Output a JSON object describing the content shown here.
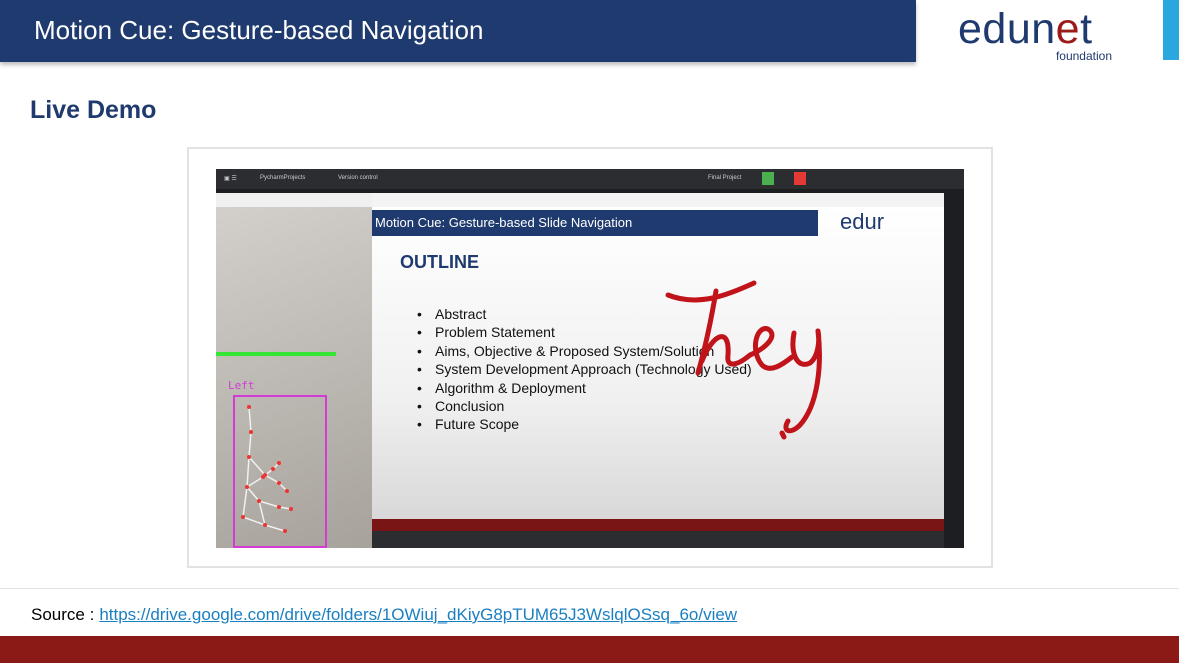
{
  "header": {
    "title": "Motion Cue: Gesture-based Navigation"
  },
  "logo": {
    "word_part1": "edun",
    "word_part2": "e",
    "word_part3": "t",
    "sub": "foundation"
  },
  "section": {
    "heading": "Live Demo"
  },
  "demo": {
    "ide": {
      "project": "PycharmProjects",
      "vcs": "Version control",
      "run_config": "Final Project"
    },
    "camera": {
      "label": "Left"
    },
    "slide": {
      "title": "Motion Cue: Gesture-based Slide Navigation",
      "logo": "edur",
      "heading": "OUTLINE",
      "items": [
        "Abstract",
        "Problem Statement",
        "Aims, Objective & Proposed System/Solution",
        "System Development Approach (Technology Used)",
        "Algorithm & Deployment",
        "Conclusion",
        "Future Scope"
      ],
      "annotation": "hey"
    }
  },
  "source": {
    "label": "Source :",
    "url": "https://drive.google.com/drive/folders/1OWiuj_dKiyG8pTUM65J3WslqlOSsq_6o/view"
  },
  "colors": {
    "navy": "#1f3a6e",
    "maroon": "#8b1a17",
    "accent_blue": "#2aa7df",
    "link": "#1a7fc1",
    "annotation": "#c0141a"
  }
}
